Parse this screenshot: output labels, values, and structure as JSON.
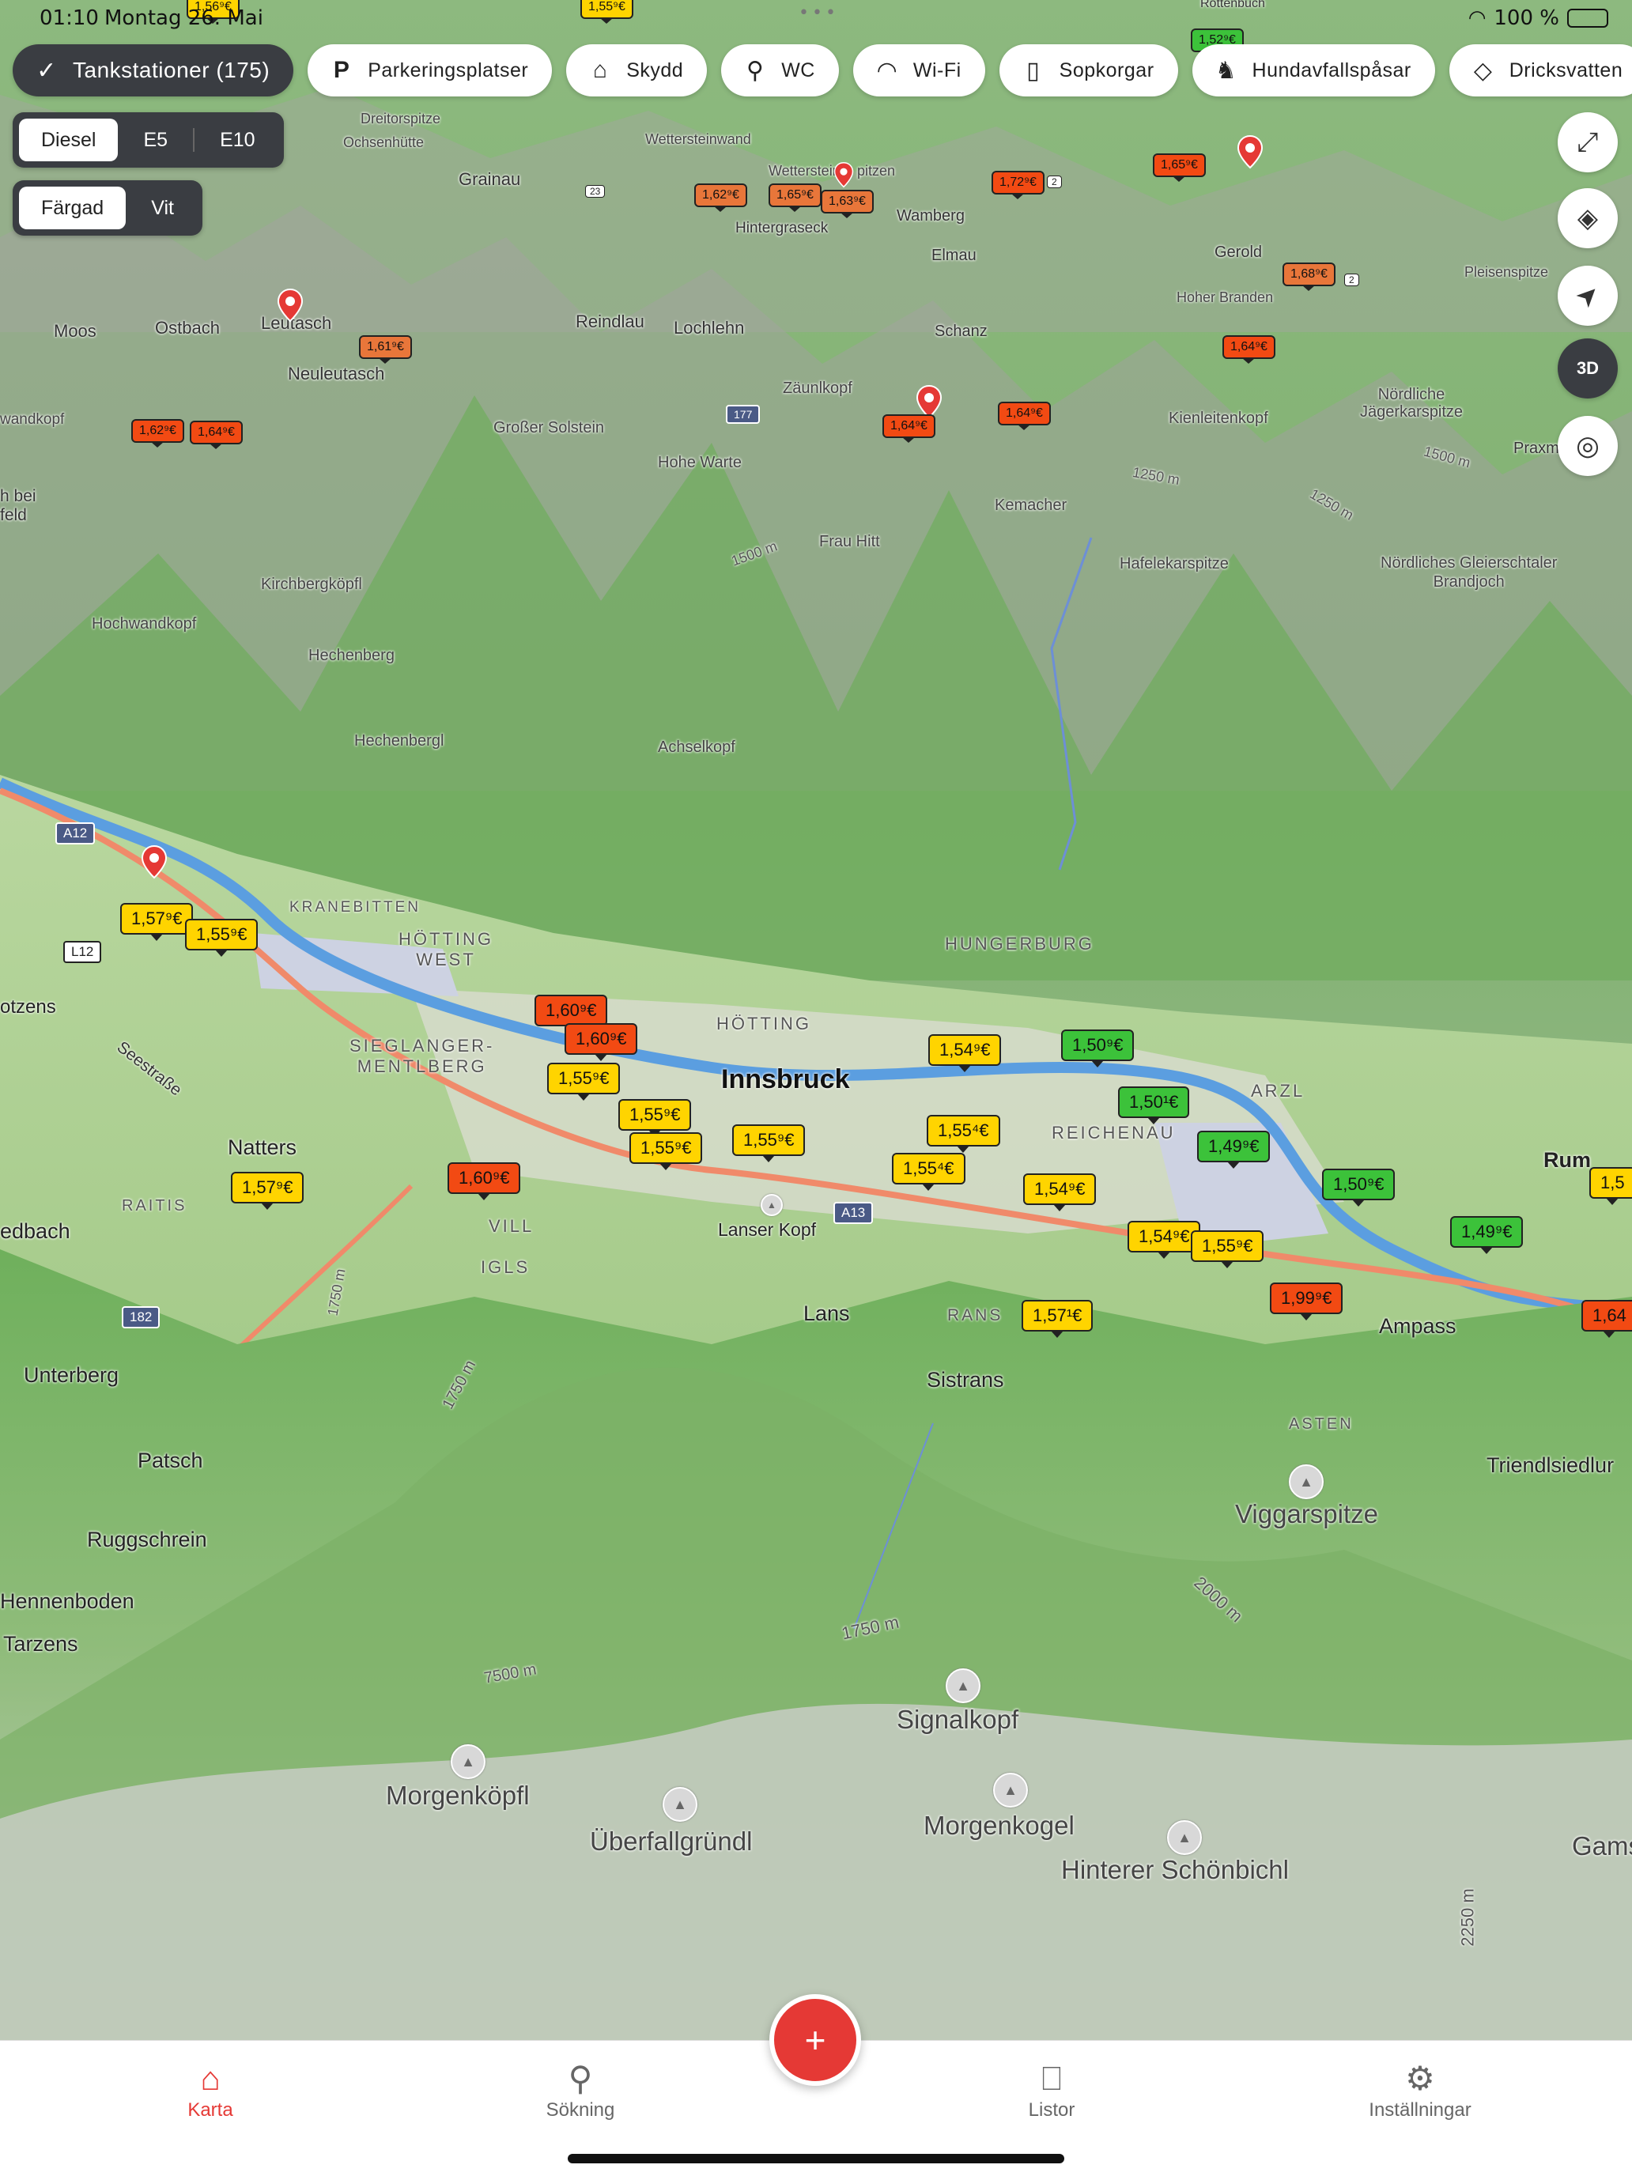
{
  "status": {
    "time": "01:10",
    "date": "Montag 26. Mai",
    "battery": "100 %"
  },
  "chips": [
    {
      "label": "Tankstationer (175)",
      "icon": "check-icon",
      "glyph": "✓",
      "active": true
    },
    {
      "label": "Parkeringsplatser",
      "icon": "parking-icon",
      "glyph": "P"
    },
    {
      "label": "Skydd",
      "icon": "shelter-icon",
      "glyph": "⌂"
    },
    {
      "label": "WC",
      "icon": "wc-icon",
      "glyph": "⚲"
    },
    {
      "label": "Wi-Fi",
      "icon": "wifi-icon",
      "glyph": "◠"
    },
    {
      "label": "Sopkorgar",
      "icon": "trash-icon",
      "glyph": "▯"
    },
    {
      "label": "Hundavfallspåsar",
      "icon": "dog-bag-icon",
      "glyph": "♞"
    },
    {
      "label": "Dricksvatten",
      "icon": "water-drop-icon",
      "glyph": "◇"
    }
  ],
  "fuel": {
    "options": [
      "Diesel",
      "E5",
      "E10"
    ],
    "selected": "Diesel"
  },
  "colorMode": {
    "options": [
      "Färgad",
      "Vit"
    ],
    "selected": "Färgad"
  },
  "controls": [
    {
      "name": "fullscreen-icon",
      "glyph": "⤢"
    },
    {
      "name": "layers-icon",
      "glyph": "◈"
    },
    {
      "name": "navigate-icon",
      "glyph": "➤"
    },
    {
      "name": "3d-toggle-icon",
      "glyph": "3D"
    },
    {
      "name": "locate-icon",
      "glyph": "◎"
    }
  ],
  "labels": {
    "innsbruck": "Innsbruck",
    "hotting": "HÖTTING",
    "hottingWest": "HÖTTING\nWEST",
    "kranebitten": "KRANEBITTEN",
    "sieglanger": "SIEGLANGER-\nMENTLBERG",
    "hungerburg": "HUNGERBURG",
    "reichenau": "REICHENAU",
    "arzl": "ARZL",
    "vill": "VILL",
    "igls": "IGLS",
    "raitis": "RAITIS",
    "asten": "ASTEN",
    "rans": "RANS",
    "natters": "Natters",
    "lanserKopf": "Lanser Kopf",
    "lans": "Lans",
    "sistrans": "Sistrans",
    "ampass": "Ampass",
    "rum": "Rum",
    "unterberg": "Unterberg",
    "patsch": "Patsch",
    "ruggschrein": "Ruggschrein",
    "hennenboden": "Hennenboden",
    "tarzens": "Tarzens",
    "edbach": "edbach",
    "otzens": "otzens",
    "triendlsiedlung": "Triendlsiedlur",
    "seestrasse": "Seestraße",
    "viggarspitze": "Viggarspitze",
    "signalkopf": "Signalkopf",
    "morgenkopfl": "Morgenköpfl",
    "uberfallgrundl": "Überfallgründl",
    "morgenkogel": "Morgenkogel",
    "hintererSchonbichl": "Hinterer Schönbichl",
    "gams": "Gams",
    "moos": "Moos",
    "ostbach": "Ostbach",
    "leutasch": "Leutasch",
    "neuleutasch": "Neuleutasch",
    "reindlau": "Reindlau",
    "lochlehn": "Lochlehn",
    "schanz": "Schanz",
    "grainau": "Grainau",
    "wamberg": "Wamberg",
    "elmau": "Elmau",
    "gerold": "Gerold",
    "hintergraseck": "Hintergraseck",
    "wettersteinwand": "Wettersteinwand",
    "wetterstein": "Wetterstein",
    "spitzen": "pitzen",
    "dreitorspitze": "Dreitorspitze",
    "ochsenhutte": "Ochsenhütte",
    "hoherBranden": "Hoher Branden",
    "pleisenspitze": "Pleisenspitze",
    "zaunlkopf": "Zäunlkopf",
    "grosserSolstein": "Großer Solstein",
    "hoheWarte": "Hohe Warte",
    "kemacher": "Kemacher",
    "frauHitt": "Frau Hitt",
    "hafelekarspitze": "Hafelekarspitze",
    "kienleitenkopf": "Kienleitenkopf",
    "nordlicheJager": "Nördliche\nJägerkarspitze",
    "nordlicheGleierschtaler": "Nördliches Gleierschtaler\nBrandjoch",
    "kirchbergkopfl": "Kirchbergköpfl",
    "hochwandkopf": "Hochwandkopf",
    "hechenberg": "Hechenberg",
    "hechenbergl": "Hechenbergl",
    "achselkopf": "Achselkopf",
    "wandkopf": "wandkopf",
    "hBei": "h bei\nfeld",
    "praxm": "Praxm",
    "rottenbuch": "Rottenbuch",
    "e1500": "1500 m",
    "e1250": "1250 m",
    "e1750a": "1750 m",
    "e1750b": "1750 m",
    "e1750c": "1750 m",
    "e2000": "2000 m",
    "e2250": "2250 m",
    "e7500": "7500 m",
    "e1250b": "1250 m",
    "e1500b": "1500 m"
  },
  "roads": {
    "a12": "A12",
    "l12": "L12",
    "a13": "A13",
    "r182": "182",
    "r177": "177",
    "r23": "23",
    "r2a": "2",
    "r2b": "2"
  },
  "prices": [
    {
      "v": "1,57⁹€",
      "c": "yellow"
    },
    {
      "v": "1,55⁹€",
      "c": "yellow"
    },
    {
      "v": "1,60⁹€",
      "c": "red"
    },
    {
      "v": "1,60⁹€",
      "c": "red"
    },
    {
      "v": "1,55⁹€",
      "c": "yellow"
    },
    {
      "v": "1,55⁹€",
      "c": "yellow"
    },
    {
      "v": "1,55⁹€",
      "c": "yellow"
    },
    {
      "v": "1,55⁹€",
      "c": "yellow"
    },
    {
      "v": "1,57⁹€",
      "c": "yellow"
    },
    {
      "v": "1,60⁹€",
      "c": "red"
    },
    {
      "v": "1,54⁹€",
      "c": "yellow"
    },
    {
      "v": "1,55⁴€",
      "c": "yellow"
    },
    {
      "v": "1,55⁴€",
      "c": "yellow"
    },
    {
      "v": "1,54⁹€",
      "c": "yellow"
    },
    {
      "v": "1,50⁹€",
      "c": "green"
    },
    {
      "v": "1,50¹€",
      "c": "green"
    },
    {
      "v": "1,49⁹€",
      "c": "green"
    },
    {
      "v": "1,54⁹€",
      "c": "yellow"
    },
    {
      "v": "1,55⁹€",
      "c": "yellow"
    },
    {
      "v": "1,50⁹€",
      "c": "green"
    },
    {
      "v": "1,49⁹€",
      "c": "green"
    },
    {
      "v": "1,99⁹€",
      "c": "red"
    },
    {
      "v": "1,57¹€",
      "c": "yellow"
    },
    {
      "v": "1,64",
      "c": "red"
    },
    {
      "v": "1,5",
      "c": "yellow"
    },
    {
      "v": "1,62⁹€",
      "c": "red"
    },
    {
      "v": "1,64⁹€",
      "c": "red"
    },
    {
      "v": "1,61⁹€",
      "c": "orange"
    },
    {
      "v": "1,64⁹€",
      "c": "red"
    },
    {
      "v": "1,64⁹€",
      "c": "red"
    },
    {
      "v": "1,64⁹€",
      "c": "red"
    },
    {
      "v": "1,62⁹€",
      "c": "orange"
    },
    {
      "v": "1,65⁹€",
      "c": "orange"
    },
    {
      "v": "1,63⁹€",
      "c": "orange"
    },
    {
      "v": "1,72⁹€",
      "c": "red"
    },
    {
      "v": "1,65⁹€",
      "c": "red"
    },
    {
      "v": "1,68⁹€",
      "c": "orange"
    },
    {
      "v": "1,56⁹€",
      "c": "yellow"
    },
    {
      "v": "1,55⁹€",
      "c": "yellow"
    },
    {
      "v": "1,52⁹€",
      "c": "green"
    }
  ],
  "colors": {
    "yellow": "#ffd400",
    "green": "#3cc23a",
    "orange": "#e8763a",
    "red": "#f24a13",
    "accent": "#e53935"
  },
  "tabs": [
    {
      "label": "Karta",
      "icon": "map-home-icon",
      "glyph": "⌂",
      "active": true
    },
    {
      "label": "Sökning",
      "icon": "search-icon",
      "glyph": "⚲"
    },
    {
      "label": "Listor",
      "icon": "bookmark-icon",
      "glyph": "⎕"
    },
    {
      "label": "Inställningar",
      "icon": "gear-icon",
      "glyph": "⚙"
    }
  ],
  "fab": {
    "icon": "add-icon",
    "glyph": "+"
  }
}
